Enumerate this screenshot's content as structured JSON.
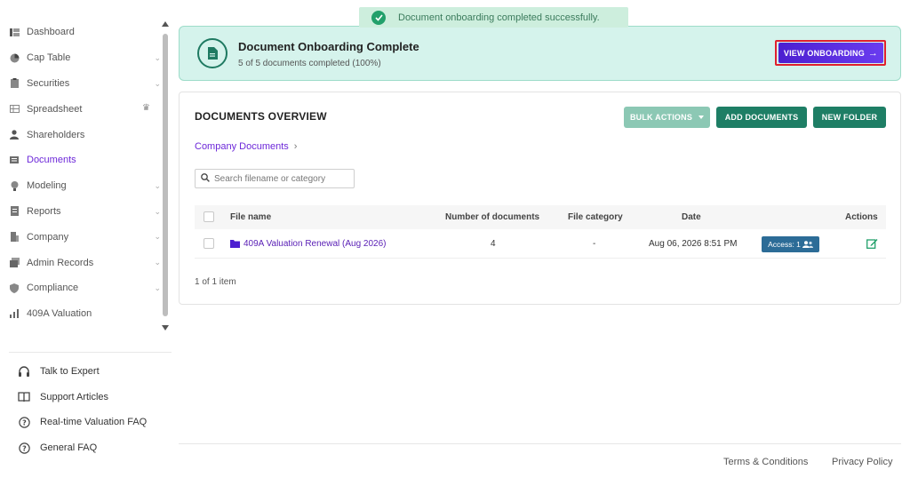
{
  "sidebar": {
    "items": [
      {
        "label": "Dashboard",
        "icon": "dashboard-icon"
      },
      {
        "label": "Cap Table",
        "icon": "pie-chart-icon",
        "expandable": true
      },
      {
        "label": "Securities",
        "icon": "clipboard-icon",
        "expandable": true
      },
      {
        "label": "Spreadsheet",
        "icon": "spreadsheet-icon",
        "badge": "crown-icon"
      },
      {
        "label": "Shareholders",
        "icon": "person-icon"
      },
      {
        "label": "Documents",
        "icon": "documents-icon",
        "active": true
      },
      {
        "label": "Modeling",
        "icon": "bulb-icon",
        "expandable": true
      },
      {
        "label": "Reports",
        "icon": "report-icon",
        "expandable": true
      },
      {
        "label": "Company",
        "icon": "building-icon",
        "expandable": true
      },
      {
        "label": "Admin Records",
        "icon": "records-icon",
        "expandable": true
      },
      {
        "label": "Compliance",
        "icon": "shield-icon",
        "expandable": true
      },
      {
        "label": "409A Valuation",
        "icon": "chart-icon"
      }
    ],
    "help": [
      {
        "label": "Talk to Expert",
        "icon": "headset-icon"
      },
      {
        "label": "Support Articles",
        "icon": "book-icon"
      },
      {
        "label": "Real-time Valuation FAQ",
        "icon": "help-circle-icon"
      },
      {
        "label": "General FAQ",
        "icon": "help-circle-icon"
      }
    ]
  },
  "toast": {
    "message": "Document onboarding completed successfully."
  },
  "banner": {
    "title": "Document Onboarding Complete",
    "subtitle": "5 of 5 documents completed (100%)",
    "button_label": "VIEW ONBOARDING",
    "progress_fraction": 1.0
  },
  "documents": {
    "title": "DOCUMENTS OVERVIEW",
    "bulk_label": "BULK ACTIONS",
    "add_label": "ADD DOCUMENTS",
    "folder_label": "NEW FOLDER",
    "breadcrumb": "Company Documents",
    "search_placeholder": "Search filename or category",
    "columns": {
      "name": "File name",
      "count": "Number of documents",
      "category": "File category",
      "date": "Date",
      "actions": "Actions"
    },
    "rows": [
      {
        "name": "409A Valuation Renewal (Aug 2026)",
        "count": "4",
        "category": "-",
        "date": "Aug 06, 2026 8:51 PM",
        "access": "Access: 1"
      }
    ],
    "pagination": "1 of 1 item"
  },
  "footer": {
    "terms": "Terms & Conditions",
    "privacy": "Privacy Policy"
  },
  "colors": {
    "accent_purple": "#6d28d9",
    "primary_green": "#1e7e65",
    "banner_bg": "#d5f3ec",
    "toast_bg": "#cdeedd",
    "access_badge": "#2c6c97",
    "highlight_outline": "#e0202d"
  }
}
